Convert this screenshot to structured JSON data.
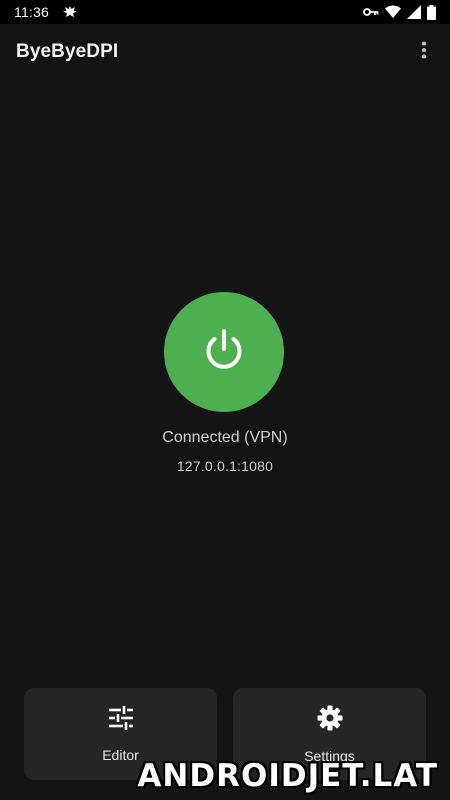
{
  "status_bar": {
    "time": "11:36",
    "icons": [
      "notification-eagle-icon",
      "vpn-key-icon",
      "wifi-icon",
      "signal-icon",
      "battery-icon"
    ]
  },
  "app_bar": {
    "title": "ByeByeDPI",
    "overflow_icon": "more-vert-icon"
  },
  "main": {
    "power_icon": "power-icon",
    "status": "Connected (VPN)",
    "address": "127.0.0.1:1080",
    "accent_color": "#4caf50"
  },
  "bottom": {
    "editor": {
      "label": "Editor",
      "icon": "tune-icon"
    },
    "settings": {
      "label": "Settings",
      "icon": "gear-icon"
    }
  },
  "watermark": "ANDROIDJET.LAT"
}
